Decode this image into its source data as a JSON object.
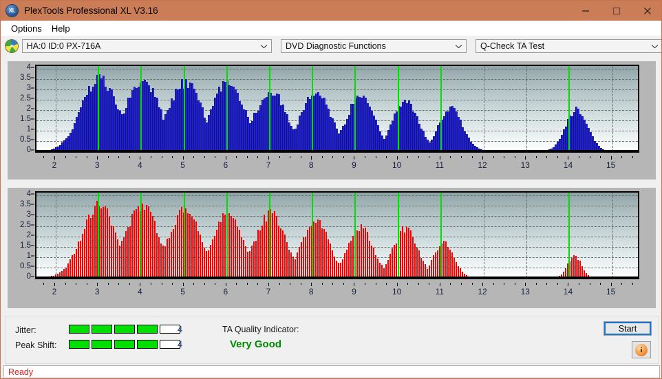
{
  "window": {
    "title": "PlexTools Professional XL V3.16",
    "icon": "XL",
    "controls": {
      "minimize": "minimize-icon",
      "maximize": "maximize-icon",
      "close": "close-icon"
    },
    "titlebar_color": "#ca7d57"
  },
  "menu": {
    "items": [
      {
        "label": "Options"
      },
      {
        "label": "Help"
      }
    ]
  },
  "toolbar": {
    "drive_icon": "disc-icon",
    "drive": {
      "value": "HA:0 ID:0  PX-716A"
    },
    "function": {
      "value": "DVD Diagnostic Functions"
    },
    "test": {
      "value": "Q-Check TA Test"
    }
  },
  "info": {
    "jitter_label": "Jitter:",
    "jitter_value": "4",
    "jitter_filled": 4,
    "jitter_total": 5,
    "peak_shift_label": "Peak Shift:",
    "peak_shift_value": "4",
    "peak_shift_filled": 4,
    "peak_shift_total": 5,
    "ta_label": "TA Quality Indicator:",
    "ta_value": "Very Good",
    "ta_color": "#008a00",
    "start_label": "Start",
    "info_label": "i"
  },
  "statusbar": {
    "text": "Ready",
    "color": "#e02020"
  },
  "chart_data": [
    {
      "id": "jitter-chart",
      "type": "bar",
      "title": "",
      "xlabel": "",
      "ylabel": "",
      "series_color": "#2222cc",
      "xlim": [
        1.55,
        15.6
      ],
      "ylim": [
        0,
        4.15
      ],
      "yticks": [
        0,
        0.5,
        1,
        1.5,
        2,
        2.5,
        3,
        3.5,
        4
      ],
      "ytick_labels": [
        "0",
        "0.5",
        "1",
        "1.5",
        "2",
        "2.5",
        "3",
        "3.5",
        "4"
      ],
      "xticks": [
        2,
        3,
        4,
        5,
        6,
        7,
        8,
        9,
        10,
        11,
        12,
        13,
        14,
        15
      ],
      "xtick_labels": [
        "2",
        "3",
        "4",
        "5",
        "6",
        "7",
        "8",
        "9",
        "10",
        "11",
        "12",
        "13",
        "14",
        "15"
      ],
      "grid": true,
      "markers": [
        3,
        4,
        5,
        6,
        7,
        8,
        9,
        10,
        11,
        14
      ],
      "marker_color": "#00e000",
      "peaks": [
        {
          "center": 3.0,
          "height": 3.75,
          "width": 0.62
        },
        {
          "center": 4.0,
          "height": 3.7,
          "width": 0.6
        },
        {
          "center": 5.0,
          "height": 3.55,
          "width": 0.6
        },
        {
          "center": 6.0,
          "height": 3.55,
          "width": 0.58
        },
        {
          "center": 7.0,
          "height": 3.1,
          "width": 0.56
        },
        {
          "center": 8.05,
          "height": 3.1,
          "width": 0.52
        },
        {
          "center": 9.1,
          "height": 2.85,
          "width": 0.48
        },
        {
          "center": 10.15,
          "height": 2.6,
          "width": 0.45
        },
        {
          "center": 11.2,
          "height": 2.2,
          "width": 0.42
        },
        {
          "center": 14.15,
          "height": 2.15,
          "width": 0.38
        }
      ],
      "noise_floor_range": [
        1.9,
        2.6
      ],
      "noise_floor_height": 0.45
    },
    {
      "id": "peak-shift-chart",
      "type": "bar",
      "title": "",
      "xlabel": "",
      "ylabel": "",
      "series_color": "#f50000",
      "xlim": [
        1.55,
        15.6
      ],
      "ylim": [
        0,
        4.15
      ],
      "yticks": [
        0,
        0.5,
        1,
        1.5,
        2,
        2.5,
        3,
        3.5,
        4
      ],
      "ytick_labels": [
        "0",
        "0.5",
        "1",
        "1.5",
        "2",
        "2.5",
        "3",
        "3.5",
        "4"
      ],
      "xticks": [
        2,
        3,
        4,
        5,
        6,
        7,
        8,
        9,
        10,
        11,
        12,
        13,
        14,
        15
      ],
      "xtick_labels": [
        "2",
        "3",
        "4",
        "5",
        "6",
        "7",
        "8",
        "9",
        "10",
        "11",
        "12",
        "13",
        "14",
        "15"
      ],
      "grid": true,
      "markers": [
        3,
        4,
        5,
        6,
        7,
        8,
        9,
        10,
        11,
        14
      ],
      "marker_color": "#00e000",
      "peaks": [
        {
          "center": 3.0,
          "height": 3.7,
          "width": 0.6
        },
        {
          "center": 4.0,
          "height": 3.7,
          "width": 0.58
        },
        {
          "center": 5.0,
          "height": 3.5,
          "width": 0.56
        },
        {
          "center": 6.0,
          "height": 3.35,
          "width": 0.54
        },
        {
          "center": 7.0,
          "height": 3.3,
          "width": 0.52
        },
        {
          "center": 8.05,
          "height": 3.0,
          "width": 0.48
        },
        {
          "center": 9.1,
          "height": 2.6,
          "width": 0.44
        },
        {
          "center": 10.15,
          "height": 2.55,
          "width": 0.42
        },
        {
          "center": 11.05,
          "height": 1.9,
          "width": 0.34
        },
        {
          "center": 14.1,
          "height": 1.15,
          "width": 0.24
        }
      ],
      "noise_floor_range": [
        2.35,
        2.6
      ],
      "noise_floor_height": 0.5
    }
  ]
}
